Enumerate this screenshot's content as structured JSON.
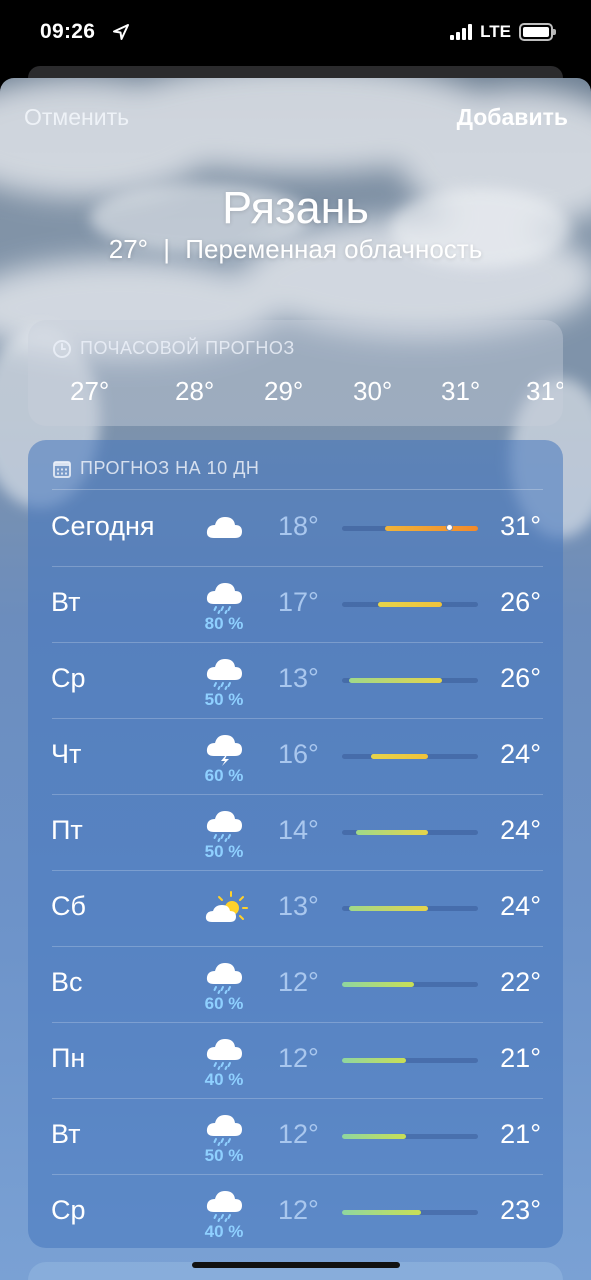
{
  "status_bar": {
    "time": "09:26",
    "network": "LTE",
    "icons": [
      "location-arrow-icon",
      "signal-icon",
      "battery-icon"
    ]
  },
  "nav": {
    "cancel": "Отменить",
    "add": "Добавить"
  },
  "location": {
    "city": "Рязань",
    "current_temp": "27°",
    "separator": "|",
    "condition": "Переменная облачность"
  },
  "hourly": {
    "title": "ПОЧАСОВОЙ ПРОГНОЗ",
    "icon": "clock-icon",
    "temps": [
      "27°",
      "28°",
      "29°",
      "30°",
      "31°",
      "31°"
    ]
  },
  "daily": {
    "title": "ПРОГНОЗ НА 10 ДН",
    "icon": "calendar-icon",
    "range_min": 12,
    "range_max": 31,
    "days": [
      {
        "day": "Сегодня",
        "icon": "cloud-icon",
        "pop": "",
        "low": "18°",
        "high": "31°",
        "low_val": 18,
        "high_val": 31,
        "current_val": 27
      },
      {
        "day": "Вт",
        "icon": "cloud-rain-icon",
        "pop": "80 %",
        "low": "17°",
        "high": "26°",
        "low_val": 17,
        "high_val": 26
      },
      {
        "day": "Ср",
        "icon": "cloud-rain-icon",
        "pop": "50 %",
        "low": "13°",
        "high": "26°",
        "low_val": 13,
        "high_val": 26
      },
      {
        "day": "Чт",
        "icon": "cloud-bolt-icon",
        "pop": "60 %",
        "low": "16°",
        "high": "24°",
        "low_val": 16,
        "high_val": 24
      },
      {
        "day": "Пт",
        "icon": "cloud-rain-icon",
        "pop": "50 %",
        "low": "14°",
        "high": "24°",
        "low_val": 14,
        "high_val": 24
      },
      {
        "day": "Сб",
        "icon": "cloud-sun-icon",
        "pop": "",
        "low": "13°",
        "high": "24°",
        "low_val": 13,
        "high_val": 24
      },
      {
        "day": "Вс",
        "icon": "cloud-rain-icon",
        "pop": "60 %",
        "low": "12°",
        "high": "22°",
        "low_val": 12,
        "high_val": 22
      },
      {
        "day": "Пн",
        "icon": "cloud-rain-icon",
        "pop": "40 %",
        "low": "12°",
        "high": "21°",
        "low_val": 12,
        "high_val": 21
      },
      {
        "day": "Вт",
        "icon": "cloud-rain-icon",
        "pop": "50 %",
        "low": "12°",
        "high": "21°",
        "low_val": 12,
        "high_val": 21
      },
      {
        "day": "Ср",
        "icon": "cloud-rain-icon",
        "pop": "40 %",
        "low": "12°",
        "high": "23°",
        "low_val": 12,
        "high_val": 23
      }
    ]
  }
}
